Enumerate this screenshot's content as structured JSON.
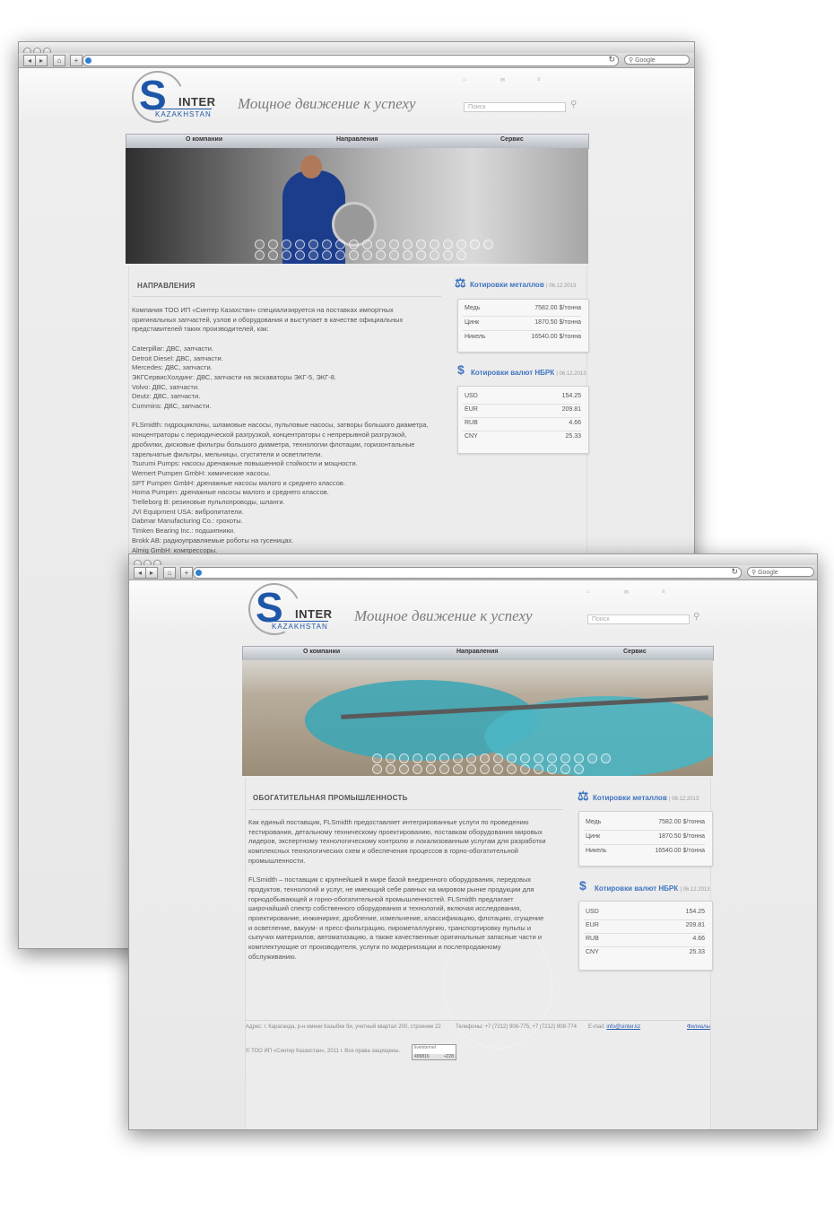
{
  "browser": {
    "search_placeholder": "Google"
  },
  "site": {
    "slogan": "Мощное движение к успеху",
    "logo": {
      "s": "S",
      "inter": "INTER",
      "kazakhstan": "KAZAKHSTAN"
    },
    "top_icons": {
      "home": "⌂",
      "mail": "✉",
      "map": "≡"
    },
    "search_placeholder": "Поиск",
    "nav": [
      "О компании",
      "Направления",
      "Сервис"
    ],
    "metals": {
      "title": "Котировки металлов",
      "date": "06.12.2013",
      "rows": [
        {
          "name": "Медь",
          "value": "7582.00 $/тонна"
        },
        {
          "name": "Цинк",
          "value": "1870.50 $/тонна"
        },
        {
          "name": "Никель",
          "value": "16540.00 $/тонна"
        }
      ]
    },
    "currency": {
      "title": "Котировки валют НБРК",
      "date": "06.12.2013",
      "rows": [
        {
          "name": "USD",
          "value": "154.25"
        },
        {
          "name": "EUR",
          "value": "209.81"
        },
        {
          "name": "RUB",
          "value": "4.66"
        },
        {
          "name": "CNY",
          "value": "25.33"
        }
      ]
    },
    "footer": {
      "address": "Адрес: г. Караганда, р-н имени Казыбек би, учетный квартал 200, строение 22",
      "phones": "Телефоны: +7 (7212) 908-775, +7 (7212) 908-774",
      "email_label": "E-mail:",
      "email": "info@sinter.kz",
      "branches": "Филиалы",
      "copyright": "© ТОО ИП «Синтер Казахстан», 2011 г. Все права защищены.",
      "counter_top": "liveinternet",
      "counter_left": "499816",
      "counter_right": "+228"
    }
  },
  "page1": {
    "heading": "НАПРАВЛЕНИЯ",
    "body": "Компания ТОО ИП «Синтер Казахстан» специализируется на поставках импортных\nоригинальных запчастей, узлов и оборудования и выступает в качестве официальных\nпредставителей таких производителей, как:\n\nCaterpillar: ДВС, запчасти.\nDetroit Diesel: ДВС, запчасти.\nMercedes: ДВС, запчасти.\nЭКГСервисХолдинг: ДВС, запчасти на экскаваторы ЭКГ-5, ЭКГ-8.\nVolvo: ДВС, запчасти.\nDeutz: ДВС, запчасти.\nCummins: ДВС, запчасти.\n\nFLSmidth: гидроциклоны, шламовые насосы, пульповые насосы, затворы большого диаметра,\nконцентраторы с периодической разгрузкой, концентраторы с непрерывной разгрузкой,\nдробилки, дисковые фильтры большого диаметра, технологии флотации, горизонтальные\nтарельчатые фильтры, мельницы, сгустители и осветлители.\nTsurumi Pumps: насосы дренажные повышенной стойкости и мощности.\nWernert Pumpen GmbH: химические насосы.\nSPT Pumpen GmbH: дренажные насосы малого и среднего классов.\nHoma Pumpen: дренажные насосы малого и среднего классов.\nTrelleborg B: резиновые пульпопроводы, шланги.\nJVI Equipment USA: вибропитатели.\nDabmar Manufacturing Co.: грохоты.\nTimken Bearing Inc.: подшипники.\nBrokk AB: радиоуправляемые роботы на гусеницах.\nAlmig GmbH: компрессоры."
  },
  "page2": {
    "heading": "ОБОГАТИТЕЛЬНАЯ ПРОМЫШЛЕННОСТЬ",
    "body": "Как единый поставщик, FLSmidth предоставляет интегрированные услуги по проведению\nтестирования, детальному техническому проектированию, поставкам оборудования мировых\nлидеров, экспертному технологическому контролю и локализованным услугам для разработки\nкомплексных технологических схем и обеспечения процессов в горно-обогатительной\nпромышленности.\n\nFLSmidth – поставщик с крупнейшей в мире базой внедренного оборудования, передовых\nпродуктов, технологий и услуг, не имеющий себе равных на мировом рынке продукции для\nгорнодобывающей и горно-обогатительной промышленностей. FLSmidth предлагает\nширочайший спектр собственного оборудования и технологий, включая исследования,\nпроектирование, инжиниринг, дробление, измельчение, классификацию, флотацию, сгущение\nи осветление, вакуум- и пресс-фильтрацию, пирометаллургию, транспортировку пульпы и\nсыпучих материалов, автоматизацию, а также качественные оригинальные запасные части и\nкомплектующие от производителя, услуги по модернизации и послепродажному\nобслуживанию."
  }
}
